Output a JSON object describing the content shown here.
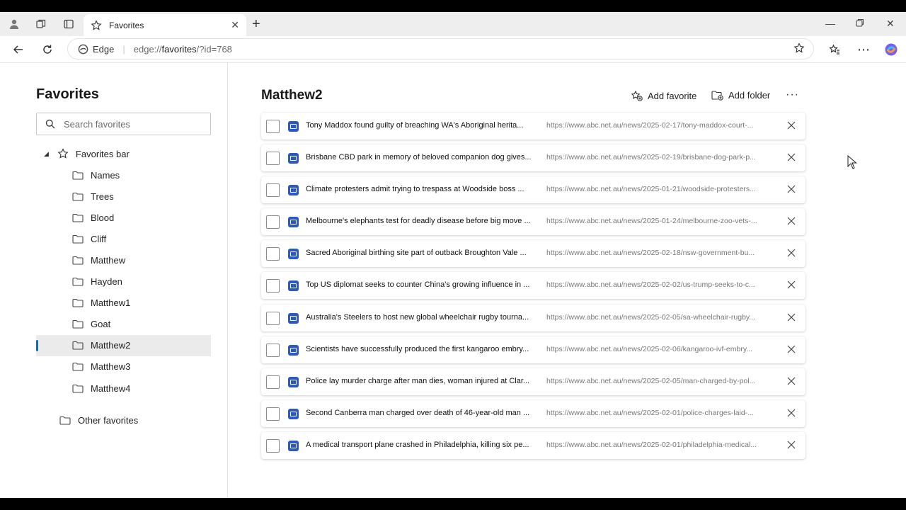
{
  "tab": {
    "title": "Favorites"
  },
  "address": {
    "edge_label": "Edge",
    "url_prefix": "edge://",
    "url_bold": "favorites",
    "url_suffix": "/?id=768"
  },
  "sidebar": {
    "title": "Favorites",
    "search_placeholder": "Search favorites",
    "root": "Favorites bar",
    "folders": [
      "Names",
      "Trees",
      "Blood",
      "Cliff",
      "Matthew",
      "Hayden",
      "Matthew1",
      "Goat",
      "Matthew2",
      "Matthew3",
      "Matthew4"
    ],
    "selected": "Matthew2",
    "other": "Other favorites"
  },
  "main": {
    "title": "Matthew2",
    "add_favorite": "Add favorite",
    "add_folder": "Add folder",
    "items": [
      {
        "title": "Tony Maddox found guilty of breaching WA's Aboriginal herita...",
        "url": "https://www.abc.net.au/news/2025-02-17/tony-maddox-court-..."
      },
      {
        "title": "Brisbane CBD park in memory of beloved companion dog gives...",
        "url": "https://www.abc.net.au/news/2025-02-19/brisbane-dog-park-p..."
      },
      {
        "title": "Climate protesters admit trying to trespass at Woodside boss ...",
        "url": "https://www.abc.net.au/news/2025-01-21/woodside-protesters..."
      },
      {
        "title": "Melbourne's elephants test for deadly disease before big move ...",
        "url": "https://www.abc.net.au/news/2025-01-24/melbourne-zoo-vets-..."
      },
      {
        "title": "Sacred Aboriginal birthing site part of outback Broughton Vale ...",
        "url": "https://www.abc.net.au/news/2025-02-18/nsw-government-bu..."
      },
      {
        "title": "Top US diplomat seeks to counter China's growing influence in ...",
        "url": "https://www.abc.net.au/news/2025-02-02/us-trump-seeks-to-c..."
      },
      {
        "title": "Australia's Steelers to host new global wheelchair rugby tourna...",
        "url": "https://www.abc.net.au/news/2025-02-05/sa-wheelchair-rugby..."
      },
      {
        "title": "Scientists have successfully produced the first kangaroo embry...",
        "url": "https://www.abc.net.au/news/2025-02-06/kangaroo-ivf-embry..."
      },
      {
        "title": "Police lay murder charge after man dies, woman injured at Clar...",
        "url": "https://www.abc.net.au/news/2025-02-05/man-charged-by-pol..."
      },
      {
        "title": "Second Canberra man charged over death of 46-year-old man ...",
        "url": "https://www.abc.net.au/news/2025-02-01/police-charges-laid-..."
      },
      {
        "title": "A medical transport plane crashed in Philadelphia, killing six pe...",
        "url": "https://www.abc.net.au/news/2025-02-01/philadelphia-medical..."
      }
    ]
  },
  "colors": {
    "accent": "#0f6cbd",
    "favicon": "#2b58c7"
  }
}
